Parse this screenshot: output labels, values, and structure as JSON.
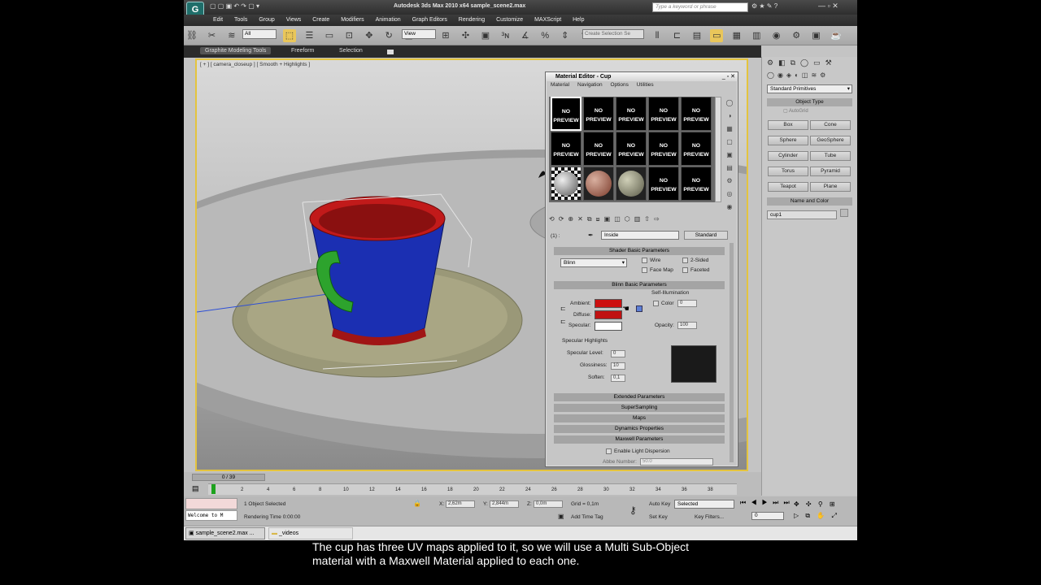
{
  "window": {
    "title": "Autodesk 3ds Max  2010 x64       sample_scene2.max",
    "search_placeholder": "Type a keyword or phrase"
  },
  "menu": [
    "Edit",
    "Tools",
    "Group",
    "Views",
    "Create",
    "Modifiers",
    "Animation",
    "Graph Editors",
    "Rendering",
    "Customize",
    "MAXScript",
    "Help"
  ],
  "toolbar": {
    "selection_filter": "All",
    "ref_coord": "View",
    "named_sel": "Create Selection Se"
  },
  "ribbon": {
    "tabs": [
      "Graphite Modeling Tools",
      "Freeform",
      "Selection"
    ]
  },
  "viewport": {
    "label": "[ + ] [ camera_closeup ] [ Smooth + Highlights ]"
  },
  "material_editor": {
    "title": "Material Editor - Cup",
    "menu": [
      "Material",
      "Navigation",
      "Options",
      "Utilities"
    ],
    "no_preview": "NO\nPREVIEW",
    "slot_label_1": "NO",
    "slot_label_2": "PREVIEW",
    "mat_number": "(1) :",
    "mat_name": "Inside",
    "mat_type": "Standard",
    "shader_hdr": "Shader Basic Parameters",
    "shader": "Blinn",
    "wire": "Wire",
    "two_sided": "2-Sided",
    "face_map": "Face Map",
    "faceted": "Faceted",
    "blinn_hdr": "Blinn Basic Parameters",
    "self_illum": "Self-Illumination",
    "color": "Color",
    "color_val": "0",
    "ambient": "Ambient:",
    "diffuse": "Diffuse:",
    "specular": "Specular:",
    "opacity": "Opacity:",
    "opacity_val": "100",
    "spec_hl": "Specular Highlights",
    "spec_level": "Specular Level:",
    "spec_level_val": "0",
    "glossiness": "Glossiness:",
    "gloss_val": "10",
    "soften": "Soften:",
    "soften_val": "0,1",
    "rollouts": [
      "Extended Parameters",
      "SuperSampling",
      "Maps",
      "Dynamics Properties",
      "Maxwell Parameters"
    ],
    "light_disp": "Enable Light Dispersion",
    "abbe": "Abbe Number:",
    "abbe_val": "50.0",
    "ambient_color": "#cc1010",
    "diffuse_color": "#c01212",
    "specular_color": "#ffffff"
  },
  "cmdpanel": {
    "dropdown": "Standard Primitives",
    "object_type": "Object Type",
    "autogrid": "AutoGrid",
    "buttons": [
      "Box",
      "Cone",
      "Sphere",
      "GeoSphere",
      "Cylinder",
      "Tube",
      "Torus",
      "Pyramid",
      "Teapot",
      "Plane"
    ],
    "name_color": "Name and Color",
    "name": "cup1"
  },
  "timeline": {
    "frame": "0 / 39",
    "ticks": [
      "0",
      "2",
      "4",
      "6",
      "8",
      "10",
      "12",
      "14",
      "16",
      "18",
      "20",
      "22",
      "24",
      "26",
      "28",
      "30",
      "32",
      "34",
      "36",
      "38"
    ]
  },
  "status": {
    "selected": "1 Object Selected",
    "render_time": "Rendering Time  0:00:00",
    "x_val": "2,62m",
    "y_val": "2,844m",
    "z_val": "0,0m",
    "grid": "Grid = 0,1m",
    "add_time_tag": "Add Time Tag",
    "auto_key": "Auto Key",
    "set_key": "Set Key",
    "key_mode": "Selected",
    "key_filters": "Key Filters...",
    "frame_val": "0",
    "welcome": "Welcome to M"
  },
  "taskbar": {
    "items": [
      "sample_scene2.max ...",
      "_videos"
    ]
  },
  "subtitle": {
    "line1": "The cup has three UV maps applied to it, so we will use a Multi Sub-Object",
    "line2": "material with a Maxwell Material applied to each one."
  }
}
